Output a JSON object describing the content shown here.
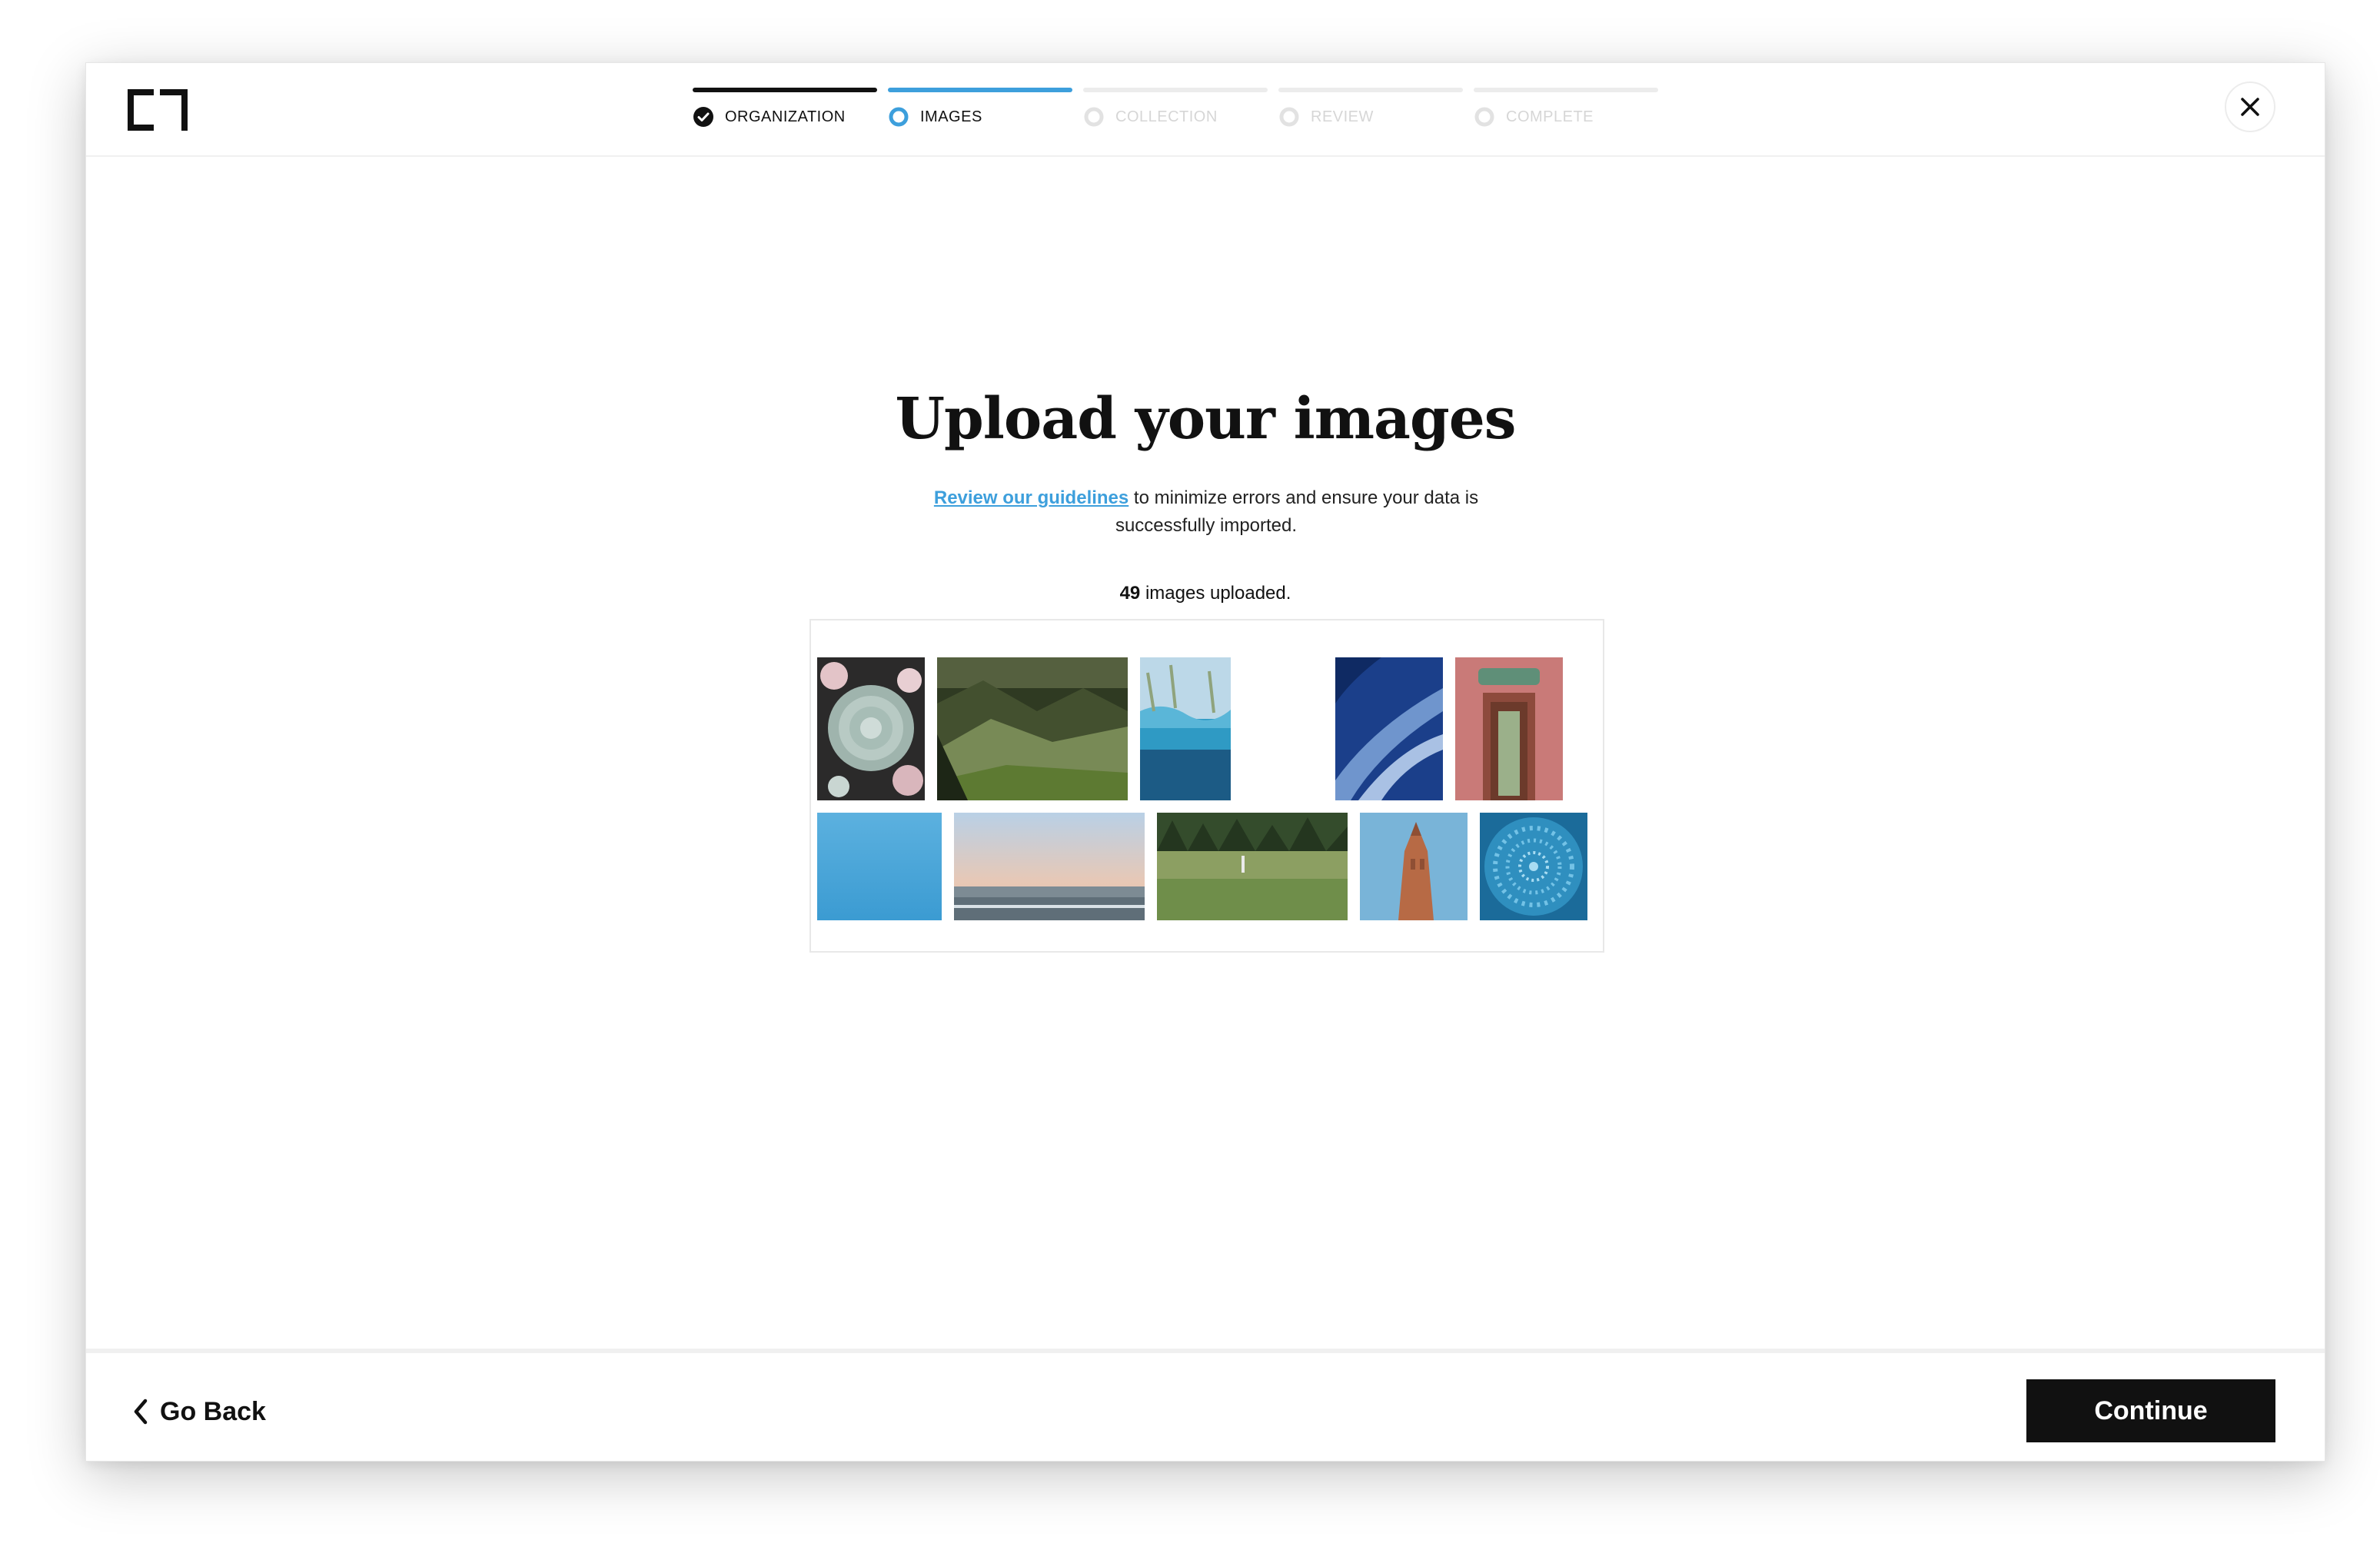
{
  "header": {
    "logo_icon": "bracket-logo-icon",
    "close_icon": "close-icon",
    "steps": [
      {
        "label": "ORGANIZATION",
        "state": "done"
      },
      {
        "label": "IMAGES",
        "state": "current"
      },
      {
        "label": "COLLECTION",
        "state": "upcoming"
      },
      {
        "label": "REVIEW",
        "state": "upcoming"
      },
      {
        "label": "COMPLETE",
        "state": "upcoming"
      }
    ]
  },
  "main": {
    "title": "Upload your images",
    "guidelines_link": "Review our guidelines",
    "subtitle_rest": " to minimize errors and ensure your data is successfully imported.",
    "count_number": "49",
    "count_text": " images uploaded.",
    "thumbnails": [
      {
        "name": "succulent-thumbnail",
        "colors": [
          "#9fb4ad",
          "#2b2a2a",
          "#e3c4c8"
        ]
      },
      {
        "name": "mountain-valley-thumbnail",
        "colors": [
          "#43502f",
          "#788a56",
          "#1d2616"
        ]
      },
      {
        "name": "underwater-thumbnail",
        "colors": [
          "#bcd8e8",
          "#2f9ac4",
          "#1c5b85"
        ]
      },
      {
        "name": "blue-sky-clouds-thumbnail",
        "colors": [
          "#1b3f8a",
          "#6f95cd",
          "#0f2a63"
        ]
      },
      {
        "name": "red-doorway-thumbnail",
        "colors": [
          "#c97a78",
          "#8d4a3c",
          "#6c3a2b"
        ]
      },
      {
        "name": "clear-sky-thumbnail",
        "colors": [
          "#4aa6d8",
          "#3b9bd2",
          "#5cb1df"
        ]
      },
      {
        "name": "beach-sunset-thumbnail",
        "colors": [
          "#b9d0e6",
          "#e8c8b5",
          "#5f6e78"
        ]
      },
      {
        "name": "forest-meadow-thumbnail",
        "colors": [
          "#344c2c",
          "#8c9f62",
          "#6f8e4a"
        ]
      },
      {
        "name": "tower-sky-thumbnail",
        "colors": [
          "#79b4d8",
          "#b76a45",
          "#8f4f34"
        ]
      },
      {
        "name": "blue-mosaic-thumbnail",
        "colors": [
          "#2f8fbf",
          "#73c2e6",
          "#1b6b9a"
        ]
      }
    ]
  },
  "footer": {
    "back_label": "Go Back",
    "back_icon": "chevron-left-icon",
    "continue_label": "Continue"
  }
}
